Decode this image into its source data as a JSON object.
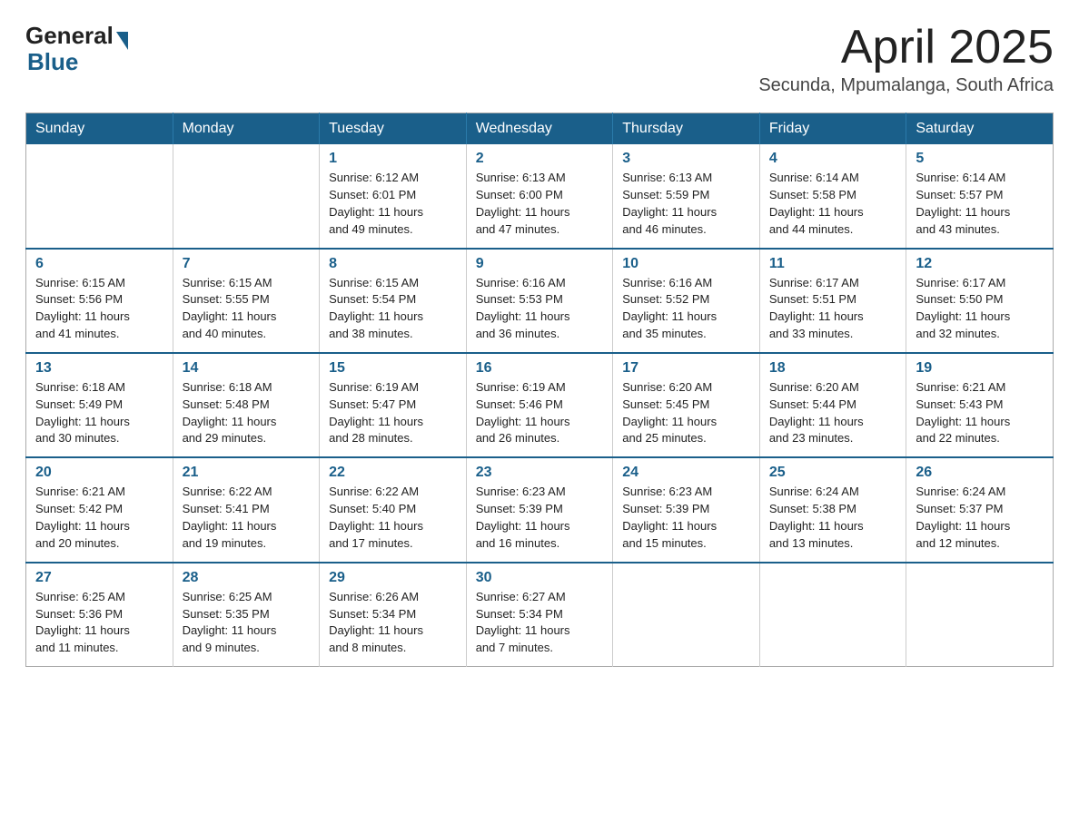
{
  "header": {
    "logo_general": "General",
    "logo_blue": "Blue",
    "title": "April 2025",
    "location": "Secunda, Mpumalanga, South Africa"
  },
  "days_of_week": [
    "Sunday",
    "Monday",
    "Tuesday",
    "Wednesday",
    "Thursday",
    "Friday",
    "Saturday"
  ],
  "weeks": [
    [
      {
        "day": "",
        "info": ""
      },
      {
        "day": "",
        "info": ""
      },
      {
        "day": "1",
        "info": "Sunrise: 6:12 AM\nSunset: 6:01 PM\nDaylight: 11 hours\nand 49 minutes."
      },
      {
        "day": "2",
        "info": "Sunrise: 6:13 AM\nSunset: 6:00 PM\nDaylight: 11 hours\nand 47 minutes."
      },
      {
        "day": "3",
        "info": "Sunrise: 6:13 AM\nSunset: 5:59 PM\nDaylight: 11 hours\nand 46 minutes."
      },
      {
        "day": "4",
        "info": "Sunrise: 6:14 AM\nSunset: 5:58 PM\nDaylight: 11 hours\nand 44 minutes."
      },
      {
        "day": "5",
        "info": "Sunrise: 6:14 AM\nSunset: 5:57 PM\nDaylight: 11 hours\nand 43 minutes."
      }
    ],
    [
      {
        "day": "6",
        "info": "Sunrise: 6:15 AM\nSunset: 5:56 PM\nDaylight: 11 hours\nand 41 minutes."
      },
      {
        "day": "7",
        "info": "Sunrise: 6:15 AM\nSunset: 5:55 PM\nDaylight: 11 hours\nand 40 minutes."
      },
      {
        "day": "8",
        "info": "Sunrise: 6:15 AM\nSunset: 5:54 PM\nDaylight: 11 hours\nand 38 minutes."
      },
      {
        "day": "9",
        "info": "Sunrise: 6:16 AM\nSunset: 5:53 PM\nDaylight: 11 hours\nand 36 minutes."
      },
      {
        "day": "10",
        "info": "Sunrise: 6:16 AM\nSunset: 5:52 PM\nDaylight: 11 hours\nand 35 minutes."
      },
      {
        "day": "11",
        "info": "Sunrise: 6:17 AM\nSunset: 5:51 PM\nDaylight: 11 hours\nand 33 minutes."
      },
      {
        "day": "12",
        "info": "Sunrise: 6:17 AM\nSunset: 5:50 PM\nDaylight: 11 hours\nand 32 minutes."
      }
    ],
    [
      {
        "day": "13",
        "info": "Sunrise: 6:18 AM\nSunset: 5:49 PM\nDaylight: 11 hours\nand 30 minutes."
      },
      {
        "day": "14",
        "info": "Sunrise: 6:18 AM\nSunset: 5:48 PM\nDaylight: 11 hours\nand 29 minutes."
      },
      {
        "day": "15",
        "info": "Sunrise: 6:19 AM\nSunset: 5:47 PM\nDaylight: 11 hours\nand 28 minutes."
      },
      {
        "day": "16",
        "info": "Sunrise: 6:19 AM\nSunset: 5:46 PM\nDaylight: 11 hours\nand 26 minutes."
      },
      {
        "day": "17",
        "info": "Sunrise: 6:20 AM\nSunset: 5:45 PM\nDaylight: 11 hours\nand 25 minutes."
      },
      {
        "day": "18",
        "info": "Sunrise: 6:20 AM\nSunset: 5:44 PM\nDaylight: 11 hours\nand 23 minutes."
      },
      {
        "day": "19",
        "info": "Sunrise: 6:21 AM\nSunset: 5:43 PM\nDaylight: 11 hours\nand 22 minutes."
      }
    ],
    [
      {
        "day": "20",
        "info": "Sunrise: 6:21 AM\nSunset: 5:42 PM\nDaylight: 11 hours\nand 20 minutes."
      },
      {
        "day": "21",
        "info": "Sunrise: 6:22 AM\nSunset: 5:41 PM\nDaylight: 11 hours\nand 19 minutes."
      },
      {
        "day": "22",
        "info": "Sunrise: 6:22 AM\nSunset: 5:40 PM\nDaylight: 11 hours\nand 17 minutes."
      },
      {
        "day": "23",
        "info": "Sunrise: 6:23 AM\nSunset: 5:39 PM\nDaylight: 11 hours\nand 16 minutes."
      },
      {
        "day": "24",
        "info": "Sunrise: 6:23 AM\nSunset: 5:39 PM\nDaylight: 11 hours\nand 15 minutes."
      },
      {
        "day": "25",
        "info": "Sunrise: 6:24 AM\nSunset: 5:38 PM\nDaylight: 11 hours\nand 13 minutes."
      },
      {
        "day": "26",
        "info": "Sunrise: 6:24 AM\nSunset: 5:37 PM\nDaylight: 11 hours\nand 12 minutes."
      }
    ],
    [
      {
        "day": "27",
        "info": "Sunrise: 6:25 AM\nSunset: 5:36 PM\nDaylight: 11 hours\nand 11 minutes."
      },
      {
        "day": "28",
        "info": "Sunrise: 6:25 AM\nSunset: 5:35 PM\nDaylight: 11 hours\nand 9 minutes."
      },
      {
        "day": "29",
        "info": "Sunrise: 6:26 AM\nSunset: 5:34 PM\nDaylight: 11 hours\nand 8 minutes."
      },
      {
        "day": "30",
        "info": "Sunrise: 6:27 AM\nSunset: 5:34 PM\nDaylight: 11 hours\nand 7 minutes."
      },
      {
        "day": "",
        "info": ""
      },
      {
        "day": "",
        "info": ""
      },
      {
        "day": "",
        "info": ""
      }
    ]
  ]
}
